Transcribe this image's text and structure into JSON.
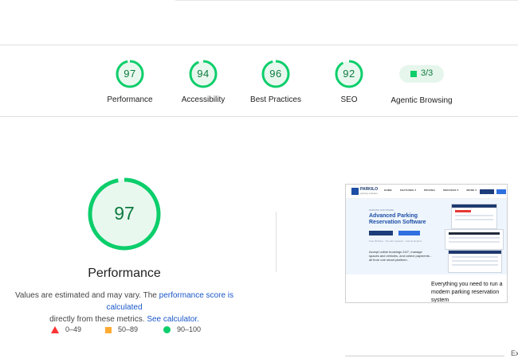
{
  "categories": [
    {
      "score": "97",
      "label": "Performance",
      "fraction": 0.97
    },
    {
      "score": "94",
      "label": "Accessibility",
      "fraction": 0.94
    },
    {
      "score": "96",
      "label": "Best Practices",
      "fraction": 0.96
    },
    {
      "score": "92",
      "label": "SEO",
      "fraction": 0.92
    }
  ],
  "agentic": {
    "badge": "3/3",
    "label": "Agentic Browsing"
  },
  "performance": {
    "score": "97",
    "fraction": 0.97,
    "title": "Performance",
    "note_prefix": "Values are estimated and may vary. The ",
    "note_link": "performance score is calculated",
    "note_mid": " directly from these metrics. ",
    "note_link2": "See calculator.",
    "legend": [
      {
        "range": "0–49",
        "color": "#ff3333"
      },
      {
        "range": "50–89",
        "color": "#ffaa33"
      },
      {
        "range": "90–100",
        "color": "#0cce6b"
      }
    ]
  },
  "screenshot": {
    "brand": "PARKILO",
    "brand_sub": "parking software",
    "nav_items": [
      "HOME",
      "FEATURES ▾",
      "PRICING",
      "SERVICES ▾",
      "MORE ▾"
    ],
    "eyebrow": "PARKING SOFTWARE",
    "headline_line1": "Advanced Parking",
    "headline_line2": "Reservation Software",
    "small_text": "Free 30 Days · No card required · Cancel anytime",
    "description": "Accept online bookings 24/7, manage spaces and vehicles, and collect payments - all from one smart platform.",
    "caption": "Everything you need to run a modern parking reservation system"
  },
  "edge_text": "Ex",
  "colors": {
    "pass": "#0cce6b",
    "pass_text": "#0c7a3e",
    "pass_bg": "#e6f6ec",
    "link": "#1a57c9"
  }
}
